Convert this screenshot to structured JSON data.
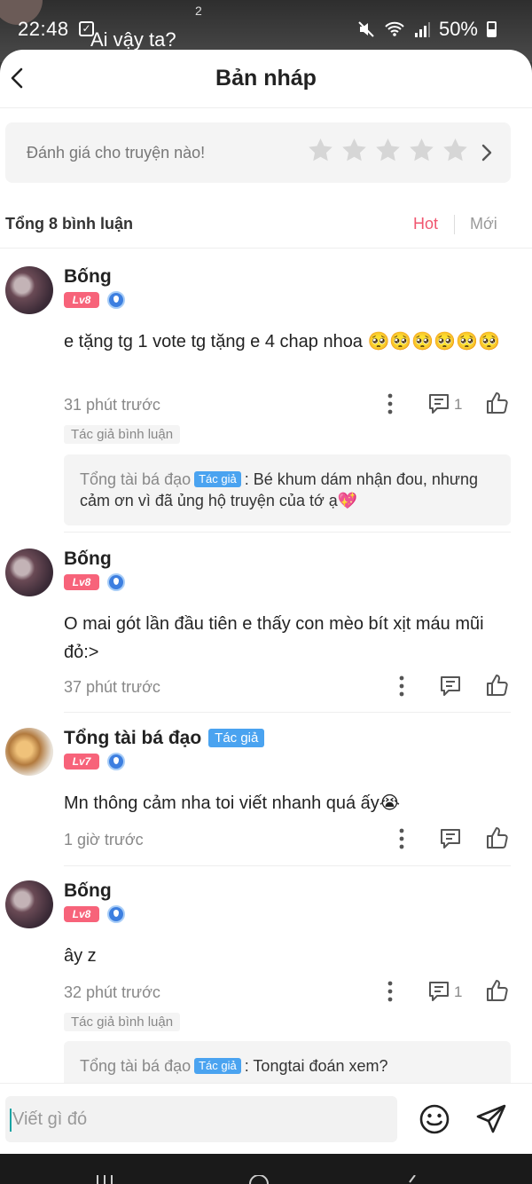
{
  "status_bar": {
    "time": "22:48",
    "battery": "50%",
    "background_title": "Ai vậy ta?",
    "background_sup": "2"
  },
  "header": {
    "title": "Bản nháp"
  },
  "rating": {
    "prompt": "Đánh giá cho truyện nào!",
    "stars": 5
  },
  "sort": {
    "total": "Tổng 8 bình luận",
    "hot": "Hot",
    "new": "Mới"
  },
  "comments": [
    {
      "name": "Bống",
      "level": "Lv8",
      "text": "e tặng tg 1 vote tg tặng e 4 chap nhoa 🥺🥺🥺🥺🥺🥺",
      "time": "31 phút trước",
      "reply_count": "1",
      "author_label": "Tác giả bình luận",
      "reply": {
        "name": "Tổng tài bá đạo",
        "tag": "Tác giả",
        "text": ": Bé khum dám nhận đou, nhưng cảm ơn vì đã ủng hộ truyện của tớ ạ💖"
      }
    },
    {
      "name": "Bống",
      "level": "Lv8",
      "text": "O mai gót lần đầu tiên e thấy con mèo bít xịt máu mũi đỏ:>",
      "time": "37 phút trước"
    },
    {
      "name": "Tổng tài bá đạo",
      "author_tag": "Tác giả",
      "level": "Lv7",
      "text": "Mn thông cảm nha toi viết nhanh quá ấy😭",
      "time": "1 giờ trước"
    },
    {
      "name": "Bống",
      "level": "Lv8",
      "text": "ây z",
      "time": "32 phút trước",
      "reply_count": "1",
      "author_label": "Tác giả bình luận",
      "reply": {
        "name": "Tổng tài bá đạo",
        "tag": "Tác giả",
        "text": ": Tongtai đoán xem?"
      }
    }
  ],
  "composer": {
    "placeholder": "Viết gì đó"
  },
  "icons": {
    "back": "chevron-left-icon",
    "star": "star-icon",
    "more": "more-vertical-icon",
    "reply": "comment-icon",
    "like": "thumbs-up-icon",
    "emoji": "smiley-icon",
    "send": "send-icon"
  },
  "colors": {
    "hot": "#f0566f",
    "author_tag": "#4aa3f0",
    "level": "#f7637a",
    "star": "#d6d6d6"
  }
}
